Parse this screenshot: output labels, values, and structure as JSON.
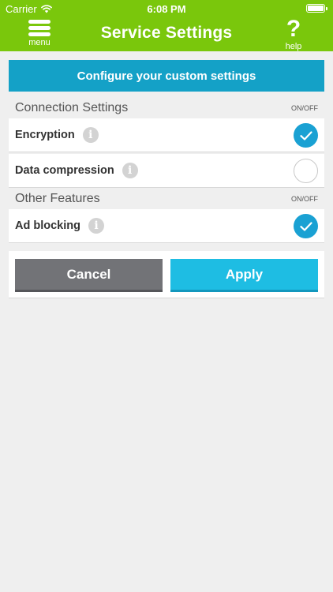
{
  "status_bar": {
    "carrier": "Carrier",
    "time": "6:08 PM",
    "battery_level": 1.0
  },
  "nav": {
    "title": "Service Settings",
    "menu_label": "menu",
    "menu_icon": "hamburger-icon",
    "help_glyph": "?",
    "help_label": "help"
  },
  "banner": {
    "text": "Configure your custom settings"
  },
  "sections": [
    {
      "title": "Connection Settings",
      "onoff_label": "ON/OFF",
      "items": [
        {
          "label": "Encryption",
          "enabled": true
        },
        {
          "label": "Data compression",
          "enabled": false
        }
      ]
    },
    {
      "title": "Other Features",
      "onoff_label": "ON/OFF",
      "items": [
        {
          "label": "Ad blocking",
          "enabled": true
        }
      ]
    }
  ],
  "info_glyph": "i",
  "buttons": {
    "cancel": "Cancel",
    "apply": "Apply"
  },
  "colors": {
    "header_green": "#7ac70c",
    "banner_blue": "#14a1c7",
    "toggle_on": "#1aa1d3",
    "cancel_gray": "#727377",
    "apply_blue": "#1ebde3"
  }
}
